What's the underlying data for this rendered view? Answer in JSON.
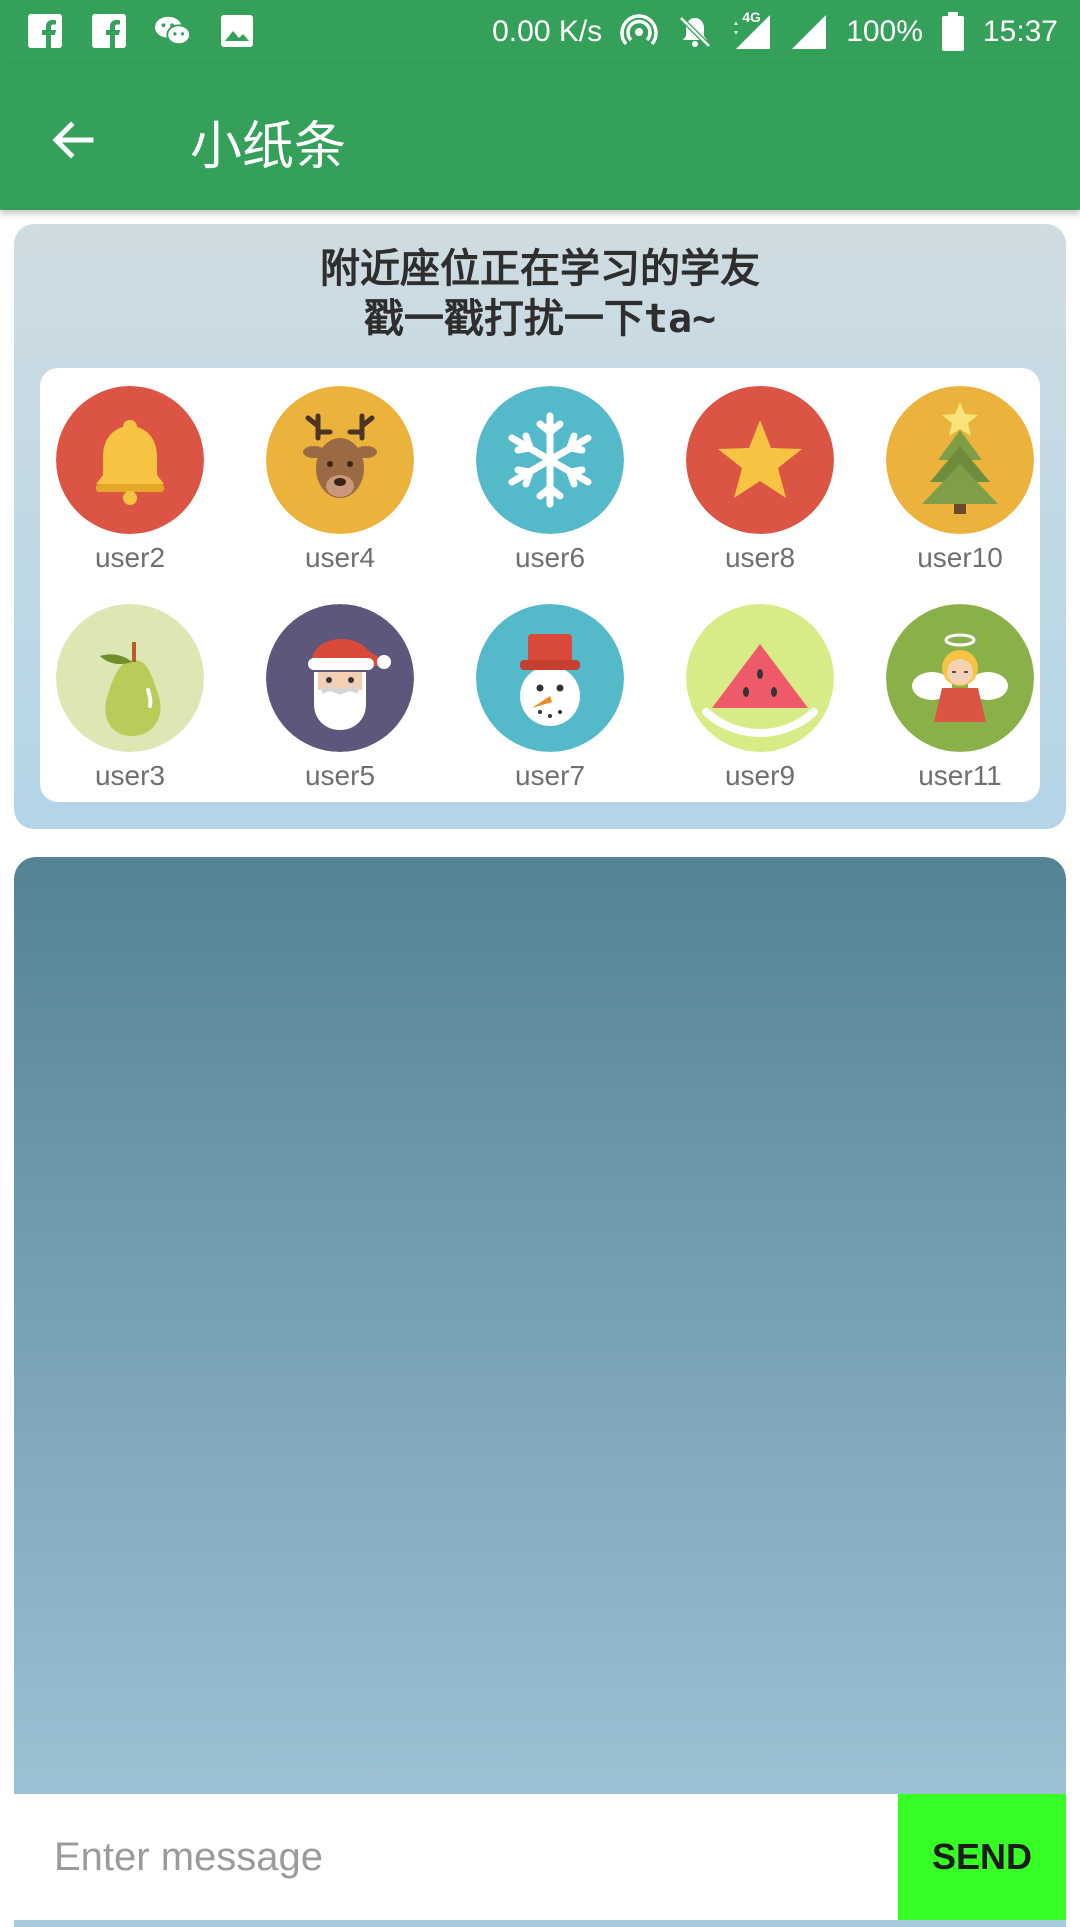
{
  "status_bar": {
    "net_speed": "0.00 K/s",
    "network": "4G",
    "battery": "100%",
    "time": "15:37",
    "left_icons": [
      "facebook-icon",
      "facebook-icon",
      "wechat-icon",
      "image-icon"
    ],
    "right_icons": [
      "hotspot-icon",
      "mute-bell-icon",
      "signal-icon",
      "signal-icon",
      "battery-icon"
    ]
  },
  "app_bar": {
    "title": "小纸条",
    "back_icon": "arrow-back-icon",
    "color": "#34a05a"
  },
  "nearby": {
    "title_line1": "附近座位正在学习的学友",
    "title_line2": "戳一戳打扰一下ta~",
    "users": [
      {
        "name": "user2",
        "icon": "bell-icon",
        "bg": "#dc5443"
      },
      {
        "name": "user4",
        "icon": "reindeer-icon",
        "bg": "#ecb33c"
      },
      {
        "name": "user6",
        "icon": "snowflake-icon",
        "bg": "#54b9c9"
      },
      {
        "name": "user8",
        "icon": "star-icon",
        "bg": "#dc5443"
      },
      {
        "name": "user10",
        "icon": "christmas-tree-icon",
        "bg": "#ecb33c"
      },
      {
        "name": "user3",
        "icon": "pear-icon",
        "bg": "#dde7b4"
      },
      {
        "name": "user5",
        "icon": "santa-icon",
        "bg": "#5c577b"
      },
      {
        "name": "user7",
        "icon": "snowman-icon",
        "bg": "#54b9c9"
      },
      {
        "name": "user9",
        "icon": "watermelon-icon",
        "bg": "#d7ec86"
      },
      {
        "name": "user11",
        "icon": "angel-icon",
        "bg": "#8ab04a"
      }
    ]
  },
  "composer": {
    "placeholder": "Enter message",
    "value": "",
    "send_label": "SEND",
    "send_color": "#37ff25"
  }
}
